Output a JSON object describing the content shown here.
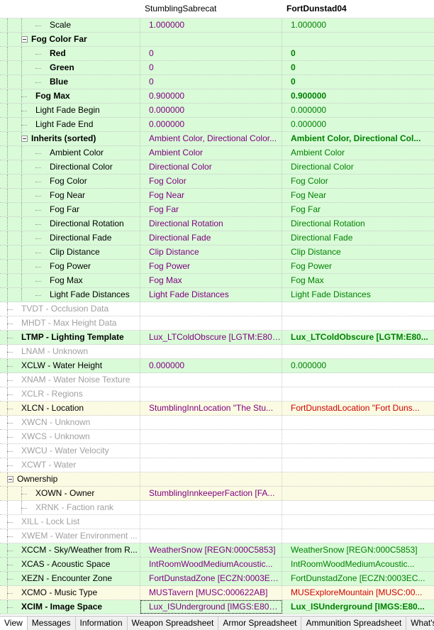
{
  "header": {
    "col0": "",
    "col1": "StumblingSabrecat",
    "col2": "FortDunstad04"
  },
  "rows": [
    {
      "label": "Scale",
      "indent": 2,
      "bg": "green",
      "style": "",
      "v1": "1.000000",
      "v1c": "purple",
      "v2": "1.000000",
      "v2c": "green-t",
      "expander": false
    },
    {
      "label": "Fog Color Far",
      "indent": 1,
      "bg": "green",
      "style": "bold",
      "v1": "",
      "v1c": "",
      "v2": "",
      "v2c": "",
      "expander": true
    },
    {
      "label": "Red",
      "indent": 2,
      "bg": "green",
      "style": "bold",
      "v1": "0",
      "v1c": "purple",
      "v2": "0",
      "v2c": "green-t bold",
      "expander": false
    },
    {
      "label": "Green",
      "indent": 2,
      "bg": "green",
      "style": "bold",
      "v1": "0",
      "v1c": "purple",
      "v2": "0",
      "v2c": "green-t bold",
      "expander": false
    },
    {
      "label": "Blue",
      "indent": 2,
      "bg": "green",
      "style": "bold",
      "v1": "0",
      "v1c": "purple",
      "v2": "0",
      "v2c": "green-t bold",
      "expander": false
    },
    {
      "label": "Fog Max",
      "indent": 1,
      "bg": "green",
      "style": "bold",
      "v1": "0.900000",
      "v1c": "purple",
      "v2": "0.900000",
      "v2c": "green-t bold",
      "expander": false
    },
    {
      "label": "Light Fade Begin",
      "indent": 1,
      "bg": "green",
      "style": "",
      "v1": "0.000000",
      "v1c": "purple",
      "v2": "0.000000",
      "v2c": "green-t",
      "expander": false
    },
    {
      "label": "Light Fade End",
      "indent": 1,
      "bg": "green",
      "style": "",
      "v1": "0.000000",
      "v1c": "purple",
      "v2": "0.000000",
      "v2c": "green-t",
      "expander": false
    },
    {
      "label": "Inherits (sorted)",
      "indent": 1,
      "bg": "green",
      "style": "bold",
      "v1": "Ambient Color, Directional Color...",
      "v1c": "purple",
      "v2": "Ambient Color, Directional Col...",
      "v2c": "green-t bold",
      "expander": true
    },
    {
      "label": "Ambient Color",
      "indent": 2,
      "bg": "green",
      "style": "",
      "v1": "Ambient Color",
      "v1c": "purple",
      "v2": "Ambient Color",
      "v2c": "green-t",
      "expander": false
    },
    {
      "label": "Directional Color",
      "indent": 2,
      "bg": "green",
      "style": "",
      "v1": "Directional Color",
      "v1c": "purple",
      "v2": "Directional Color",
      "v2c": "green-t",
      "expander": false
    },
    {
      "label": "Fog Color",
      "indent": 2,
      "bg": "green",
      "style": "",
      "v1": "Fog Color",
      "v1c": "purple",
      "v2": "Fog Color",
      "v2c": "green-t",
      "expander": false
    },
    {
      "label": "Fog Near",
      "indent": 2,
      "bg": "green",
      "style": "",
      "v1": "Fog Near",
      "v1c": "purple",
      "v2": "Fog Near",
      "v2c": "green-t",
      "expander": false
    },
    {
      "label": "Fog Far",
      "indent": 2,
      "bg": "green",
      "style": "",
      "v1": "Fog Far",
      "v1c": "purple",
      "v2": "Fog Far",
      "v2c": "green-t",
      "expander": false
    },
    {
      "label": "Directional Rotation",
      "indent": 2,
      "bg": "green",
      "style": "",
      "v1": "Directional Rotation",
      "v1c": "purple",
      "v2": "Directional Rotation",
      "v2c": "green-t",
      "expander": false
    },
    {
      "label": "Directional Fade",
      "indent": 2,
      "bg": "green",
      "style": "",
      "v1": "Directional Fade",
      "v1c": "purple",
      "v2": "Directional Fade",
      "v2c": "green-t",
      "expander": false
    },
    {
      "label": "Clip Distance",
      "indent": 2,
      "bg": "green",
      "style": "",
      "v1": "Clip Distance",
      "v1c": "purple",
      "v2": "Clip Distance",
      "v2c": "green-t",
      "expander": false
    },
    {
      "label": "Fog Power",
      "indent": 2,
      "bg": "green",
      "style": "",
      "v1": "Fog Power",
      "v1c": "purple",
      "v2": "Fog Power",
      "v2c": "green-t",
      "expander": false
    },
    {
      "label": "Fog Max",
      "indent": 2,
      "bg": "green",
      "style": "",
      "v1": "Fog Max",
      "v1c": "purple",
      "v2": "Fog Max",
      "v2c": "green-t",
      "expander": false
    },
    {
      "label": "Light Fade Distances",
      "indent": 2,
      "bg": "green",
      "style": "",
      "v1": "Light Fade Distances",
      "v1c": "purple",
      "v2": "Light Fade Distances",
      "v2c": "green-t",
      "expander": false
    },
    {
      "label": "TVDT - Occlusion Data",
      "indent": 0,
      "bg": "white",
      "style": "gray",
      "v1": "",
      "v1c": "",
      "v2": "",
      "v2c": "",
      "expander": false
    },
    {
      "label": "MHDT - Max Height Data",
      "indent": 0,
      "bg": "white",
      "style": "gray",
      "v1": "",
      "v1c": "",
      "v2": "",
      "v2c": "",
      "expander": false
    },
    {
      "label": "LTMP - Lighting Template",
      "indent": 0,
      "bg": "green",
      "style": "bold",
      "v1": "Lux_LTColdObscure [LGTM:E809...",
      "v1c": "purple",
      "v2": "Lux_LTColdObscure [LGTM:E80...",
      "v2c": "green-t bold",
      "expander": false
    },
    {
      "label": "LNAM - Unknown",
      "indent": 0,
      "bg": "white",
      "style": "gray",
      "v1": "",
      "v1c": "",
      "v2": "",
      "v2c": "",
      "expander": false
    },
    {
      "label": "XCLW - Water Height",
      "indent": 0,
      "bg": "green",
      "style": "",
      "v1": "0.000000",
      "v1c": "purple",
      "v2": "0.000000",
      "v2c": "green-t",
      "expander": false
    },
    {
      "label": "XNAM - Water Noise Texture",
      "indent": 0,
      "bg": "white",
      "style": "gray",
      "v1": "",
      "v1c": "",
      "v2": "",
      "v2c": "",
      "expander": false
    },
    {
      "label": "XCLR - Regions",
      "indent": 0,
      "bg": "white",
      "style": "gray",
      "v1": "",
      "v1c": "",
      "v2": "",
      "v2c": "",
      "expander": false
    },
    {
      "label": "XLCN - Location",
      "indent": 0,
      "bg": "yellow",
      "style": "",
      "v1": "StumblingInnLocation \"The Stu...",
      "v1c": "purple",
      "v2": "FortDunstadLocation \"Fort Duns...",
      "v2c": "red-t",
      "expander": false
    },
    {
      "label": "XWCN - Unknown",
      "indent": 0,
      "bg": "white",
      "style": "gray",
      "v1": "",
      "v1c": "",
      "v2": "",
      "v2c": "",
      "expander": false
    },
    {
      "label": "XWCS - Unknown",
      "indent": 0,
      "bg": "white",
      "style": "gray",
      "v1": "",
      "v1c": "",
      "v2": "",
      "v2c": "",
      "expander": false
    },
    {
      "label": "XWCU - Water Velocity",
      "indent": 0,
      "bg": "white",
      "style": "gray",
      "v1": "",
      "v1c": "",
      "v2": "",
      "v2c": "",
      "expander": false
    },
    {
      "label": "XCWT - Water",
      "indent": 0,
      "bg": "white",
      "style": "gray",
      "v1": "",
      "v1c": "",
      "v2": "",
      "v2c": "",
      "expander": false
    },
    {
      "label": "Ownership",
      "indent": 0,
      "bg": "yellow",
      "style": "",
      "v1": "",
      "v1c": "",
      "v2": "",
      "v2c": "",
      "expander": true
    },
    {
      "label": "XOWN - Owner",
      "indent": 1,
      "bg": "yellow",
      "style": "",
      "v1": "StumblingInnkeeperFaction [FA...",
      "v1c": "purple",
      "v2": "",
      "v2c": "",
      "expander": false
    },
    {
      "label": "XRNK - Faction rank",
      "indent": 1,
      "bg": "white",
      "style": "gray",
      "v1": "",
      "v1c": "",
      "v2": "",
      "v2c": "",
      "expander": false
    },
    {
      "label": "XILL - Lock List",
      "indent": 0,
      "bg": "white",
      "style": "gray",
      "v1": "",
      "v1c": "",
      "v2": "",
      "v2c": "",
      "expander": false
    },
    {
      "label": "XWEM - Water Environment ...",
      "indent": 0,
      "bg": "white",
      "style": "gray",
      "v1": "",
      "v1c": "",
      "v2": "",
      "v2c": "",
      "expander": false
    },
    {
      "label": "XCCM - Sky/Weather from R...",
      "indent": 0,
      "bg": "green",
      "style": "",
      "v1": "WeatherSnow [REGN:000C5853]",
      "v1c": "purple",
      "v2": "WeatherSnow [REGN:000C5853]",
      "v2c": "green-t",
      "expander": false
    },
    {
      "label": "XCAS - Acoustic Space",
      "indent": 0,
      "bg": "green",
      "style": "",
      "v1": "IntRoomWoodMediumAcoustic...",
      "v1c": "purple",
      "v2": "IntRoomWoodMediumAcoustic...",
      "v2c": "green-t",
      "expander": false
    },
    {
      "label": "XEZN - Encounter Zone",
      "indent": 0,
      "bg": "green",
      "style": "",
      "v1": "FortDunstadZone [ECZN:0003EC...",
      "v1c": "purple",
      "v2": "FortDunstadZone [ECZN:0003EC...",
      "v2c": "green-t",
      "expander": false
    },
    {
      "label": "XCMO - Music Type",
      "indent": 0,
      "bg": "yellow",
      "style": "",
      "v1": "MUSTavern [MUSC:000622AB]",
      "v1c": "purple",
      "v2": "MUSExploreMountain [MUSC:00...",
      "v2c": "red-t",
      "expander": false
    },
    {
      "label": "XCIM - Image Space",
      "indent": 0,
      "bg": "green",
      "style": "bold",
      "v1": "Lux_ISUnderground [IMGS:E8097...",
      "v1c": "purple",
      "v2": "Lux_ISUnderground [IMGS:E80...",
      "v2c": "green-t bold",
      "expander": false
    }
  ],
  "tabs": [
    "View",
    "Messages",
    "Information",
    "Weapon Spreadsheet",
    "Armor Spreadsheet",
    "Ammunition Spreadsheet",
    "What's New"
  ],
  "active_tab": 0
}
